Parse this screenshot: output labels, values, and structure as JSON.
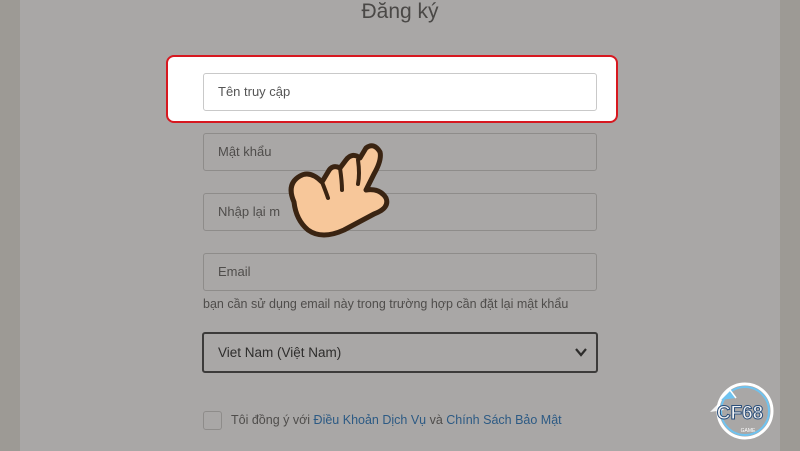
{
  "form": {
    "title": "Đăng ký",
    "username_placeholder": "Tên truy cập",
    "password_placeholder": "Mật khẩu",
    "confirm_password_placeholder": "Nhập lại mật khẩu",
    "confirm_password_visible": "Nhập lại m",
    "email_placeholder": "Email",
    "email_helper": "bạn cần sử dụng email này trong trường hợp cần đặt lại mật khẩu",
    "country_selected": "Viet Nam (Việt Nam)",
    "agree_prefix": "Tôi đồng ý với ",
    "terms_link": "Điều Khoản Dịch Vụ",
    "agree_and": " và ",
    "privacy_link": "Chính Sách Bảo Mật",
    "agree_checked": false
  },
  "overlay": {
    "hand_icon": "pointing-hand-icon",
    "highlight_color": "#d71820"
  },
  "watermark": {
    "logo_text": "CF68",
    "logo_subtext": "GAME"
  }
}
